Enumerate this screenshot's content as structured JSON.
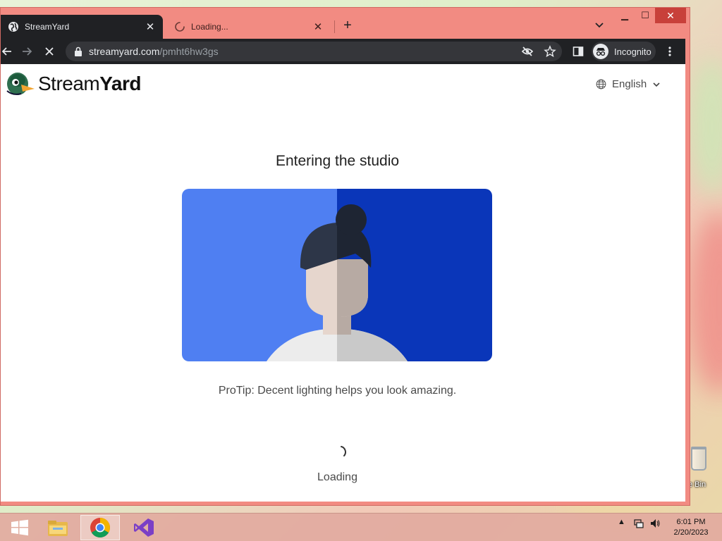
{
  "browser": {
    "tabs": [
      {
        "title": "StreamYard",
        "state": "active"
      },
      {
        "title": "Loading...",
        "state": "loading"
      }
    ],
    "url_host": "streamyard.com",
    "url_path": "/pmht6hw3gs",
    "profile_label": "Incognito",
    "icons": {
      "back": "arrow-left-icon",
      "forward": "arrow-right-icon",
      "stop": "close-icon",
      "lock": "lock-icon",
      "eye_off": "eye-off-icon",
      "star": "star-icon",
      "sidepanel": "side-panel-icon",
      "menu": "kebab-menu-icon"
    }
  },
  "page": {
    "brand_light": "Stream",
    "brand_bold": "Yard",
    "language": "English",
    "heading": "Entering the studio",
    "protip": "ProTip: Decent lighting helps you look amazing.",
    "status": "Loading"
  },
  "desktop": {
    "recycle_bin_label": "e Bin"
  },
  "taskbar": {
    "apps": [
      "windows-start",
      "file-explorer",
      "chrome",
      "visual-studio"
    ],
    "time": "6:01 PM",
    "date": "2/20/2023"
  },
  "colors": {
    "window_frame": "#f28b82",
    "chrome_dark": "#202124",
    "illus_light_blue": "#4f7ff2",
    "illus_dark_blue": "#0a36b9"
  }
}
